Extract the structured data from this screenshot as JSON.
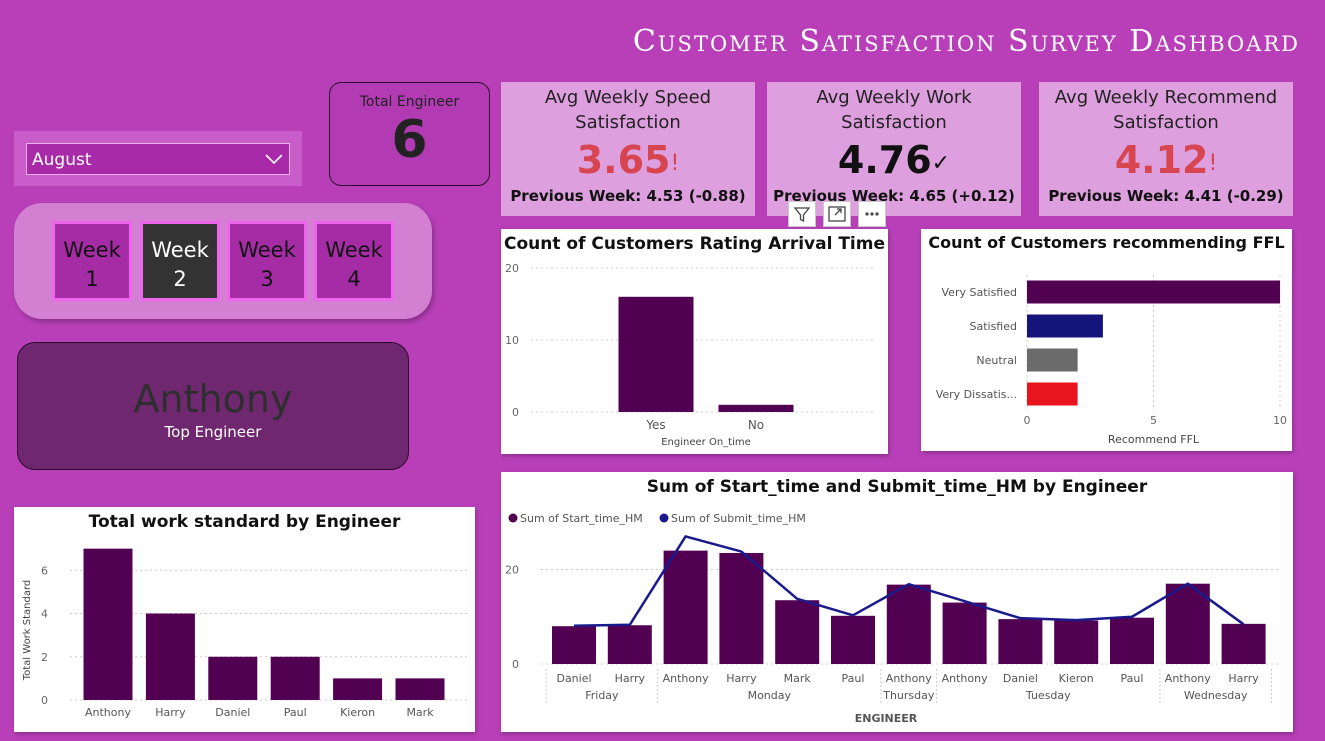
{
  "dashboard": {
    "title": "Customer Satisfaction Survey Dashboard"
  },
  "filter": {
    "month": "August"
  },
  "total_engineer": {
    "label": "Total Engineer",
    "value": "6"
  },
  "kpis": [
    {
      "label": "Avg Weekly Speed Satisfaction",
      "value": "3.65",
      "mark": "!",
      "previous": "Previous Week: 4.53 (-0.88)",
      "color": "#d64550"
    },
    {
      "label": "Avg Weekly Work Satisfaction",
      "value": "4.76",
      "mark": "✓",
      "previous": "Previous Week: 4.65 (+0.12)",
      "color": "#111111"
    },
    {
      "label": "Avg Weekly Recommend Satisfaction",
      "value": "4.12",
      "mark": "!",
      "previous": "Previous Week: 4.41 (-0.29)",
      "color": "#d64550"
    }
  ],
  "weeks": [
    {
      "line1": "Week",
      "line2": "1",
      "active": false
    },
    {
      "line1": "Week",
      "line2": "2",
      "active": true
    },
    {
      "line1": "Week",
      "line2": "3",
      "active": false
    },
    {
      "line1": "Week",
      "line2": "4",
      "active": false
    }
  ],
  "top_engineer": {
    "name": "Anthony",
    "label": "Top Engineer"
  },
  "visual_toolbar": {
    "icons": [
      "filter-icon",
      "focus-mode-icon",
      "more-options-icon"
    ]
  },
  "chart_data": [
    {
      "id": "arrival",
      "type": "bar",
      "title": "Count of Customers Rating Arrival Time",
      "xlabel": "Engineer On_time",
      "ylabel": "",
      "categories": [
        "Yes",
        "No"
      ],
      "values": [
        16,
        1
      ],
      "ylim": [
        0,
        20
      ],
      "yticks": [
        0,
        10,
        20
      ],
      "color": "#520052",
      "grid": true
    },
    {
      "id": "recommend",
      "type": "bar",
      "orientation": "horizontal",
      "title": "Count of Customers recommending FFL",
      "xlabel": "Recommend FFL",
      "ylabel": "",
      "categories": [
        "Very Satisfied",
        "Satisfied",
        "Neutral",
        "Very Dissatis..."
      ],
      "values": [
        10,
        3,
        2,
        2
      ],
      "colors": [
        "#520052",
        "#14147a",
        "#6b6b6b",
        "#e8141e"
      ],
      "xlim": [
        0,
        10
      ],
      "xticks": [
        0,
        5,
        10
      ],
      "grid": true
    },
    {
      "id": "workstd",
      "type": "bar",
      "title": "Total work standard by Engineer",
      "xlabel": "",
      "ylabel": "Total Work Standard",
      "categories": [
        "Anthony",
        "Harry",
        "Daniel",
        "Paul",
        "Kieron",
        "Mark"
      ],
      "values": [
        7,
        4,
        2,
        2,
        1,
        1
      ],
      "ylim": [
        0,
        7.4
      ],
      "yticks": [
        0,
        2,
        4,
        6
      ],
      "color": "#520052",
      "grid": true
    },
    {
      "id": "times",
      "type": "bar",
      "title": "Sum of Start_time and Submit_time_HM by Engineer",
      "xlabel": "ENGINEER",
      "ylabel": "",
      "legend_position": "top-left",
      "categories": [
        "Daniel",
        "Harry",
        "Anthony",
        "Harry",
        "Mark",
        "Paul",
        "Anthony",
        "Anthony",
        "Daniel",
        "Kieron",
        "Paul",
        "Anthony",
        "Harry"
      ],
      "groups": [
        {
          "label": "Friday",
          "count": 2
        },
        {
          "label": "Monday",
          "count": 4
        },
        {
          "label": "Thursday",
          "count": 1
        },
        {
          "label": "Tuesday",
          "count": 4
        },
        {
          "label": "Wednesday",
          "count": 2
        }
      ],
      "series": [
        {
          "name": "Sum of Start_time_HM",
          "type": "bar",
          "color": "#520052",
          "values": [
            8,
            8.2,
            24,
            23.5,
            13.5,
            10.2,
            16.8,
            13,
            9.5,
            9.2,
            9.8,
            17,
            8.5
          ]
        },
        {
          "name": "Sum of Submit_time_HM",
          "type": "line",
          "color": "#1a1a8c",
          "values": [
            8.1,
            8.3,
            27,
            23.8,
            13.8,
            10.3,
            16.9,
            13.3,
            9.7,
            9.3,
            10,
            17,
            8.4
          ]
        }
      ],
      "ylim": [
        0,
        29
      ],
      "yticks": [
        0,
        20
      ],
      "grid": true
    }
  ]
}
